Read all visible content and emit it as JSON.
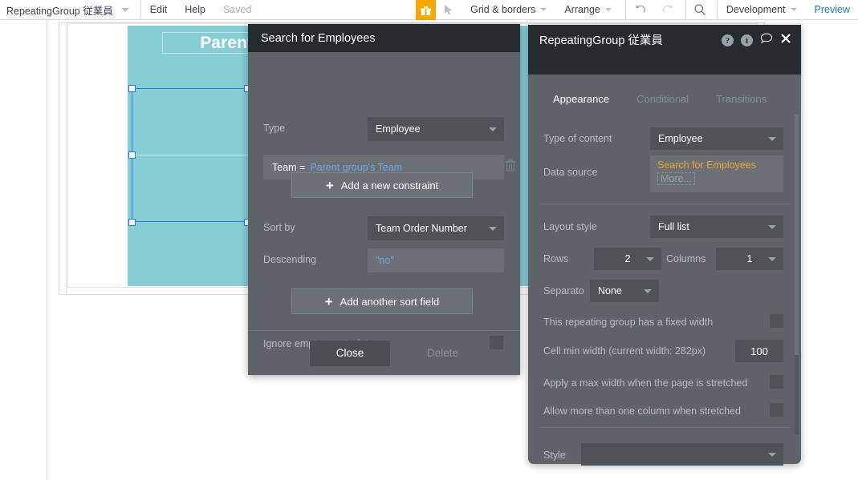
{
  "topbar": {
    "app_title": "RepeatingGroup 従業員",
    "edit": "Edit",
    "help": "Help",
    "saved": "Saved",
    "grid_borders": "Grid & borders",
    "arrange": "Arrange",
    "version": "Development",
    "preview": "Preview",
    "icons": {
      "gift": "gift-icon",
      "cursor": "cursor-arrow-icon",
      "undo": "undo-icon",
      "redo": "redo-icon",
      "search": "search-icon"
    }
  },
  "canvas": {
    "parent_group_text": "Parent group's T",
    "group_color": "#86cdd4",
    "selection_color": "#1d7fe0"
  },
  "search_dialog": {
    "title": "Search for Employees",
    "type_label": "Type",
    "type_value": "Employee",
    "constraint": {
      "key": "Team =",
      "value": "Parent group's Team"
    },
    "add_constraint": "Add a new constraint",
    "sort_by_label": "Sort by",
    "sort_by_value": "Team Order Number",
    "descending_label": "Descending",
    "descending_value": "\"no\"",
    "add_sort_field": "Add another sort field",
    "ignore_empty_label": "Ignore empty constraints",
    "close_button": "Close",
    "delete_button": "Delete"
  },
  "element_dialog": {
    "title": "RepeatingGroup 従業員",
    "tabs": [
      {
        "label": "Appearance",
        "active": true
      },
      {
        "label": "Conditional",
        "active": false
      },
      {
        "label": "Transitions",
        "active": false
      }
    ],
    "type_of_content_label": "Type of content",
    "type_of_content_value": "Employee",
    "data_source_label": "Data source",
    "data_source_value": "Search for Employees",
    "data_source_more": "More...",
    "data_source_color": "#f0a32a",
    "layout_style_label": "Layout style",
    "layout_style_value": "Full list",
    "rows_label": "Rows",
    "rows_value": "2",
    "columns_label": "Columns",
    "columns_value": "1",
    "separator_label": "Separato",
    "separator_value": "None",
    "fixed_width_label": "This repeating group has a fixed width",
    "cell_min_width_label": "Cell min width (current width: 282px)",
    "cell_min_width_value": "100",
    "max_width_label": "Apply a max width when the page is stretched",
    "multi_column_label": "Allow more than one column when stretched",
    "style_label": "Style",
    "style_value": ""
  }
}
